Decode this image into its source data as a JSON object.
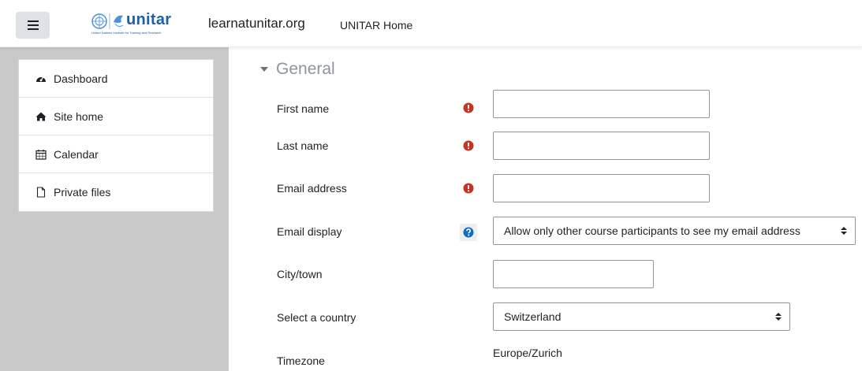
{
  "navbar": {
    "menu_icon": "hamburger-icon",
    "logo_text": "unitar",
    "logo_tagline": "United Nations Institute for Training and Research",
    "site_title": "learnatunitar.org",
    "home_link": "UNITAR Home"
  },
  "drawer": {
    "items": [
      {
        "label": "Dashboard",
        "icon": "dashboard-icon"
      },
      {
        "label": "Site home",
        "icon": "home-icon"
      },
      {
        "label": "Calendar",
        "icon": "calendar-icon"
      },
      {
        "label": "Private files",
        "icon": "file-icon"
      }
    ]
  },
  "form": {
    "section_title": "General",
    "first_name": {
      "label": "First name",
      "value": ""
    },
    "last_name": {
      "label": "Last name",
      "value": ""
    },
    "email": {
      "label": "Email address",
      "value": ""
    },
    "email_display": {
      "label": "Email display",
      "value": "Allow only other course participants to see my email address"
    },
    "city": {
      "label": "City/town",
      "value": ""
    },
    "country": {
      "label": "Select a country",
      "value": "Switzerland"
    },
    "timezone": {
      "label": "Timezone",
      "value": "Europe/Zurich"
    }
  },
  "colors": {
    "required": "#ca3120",
    "help": "#0f6cbf",
    "drawer_bg": "#c9c9c9",
    "logo_blue": "#1d5fa8"
  }
}
